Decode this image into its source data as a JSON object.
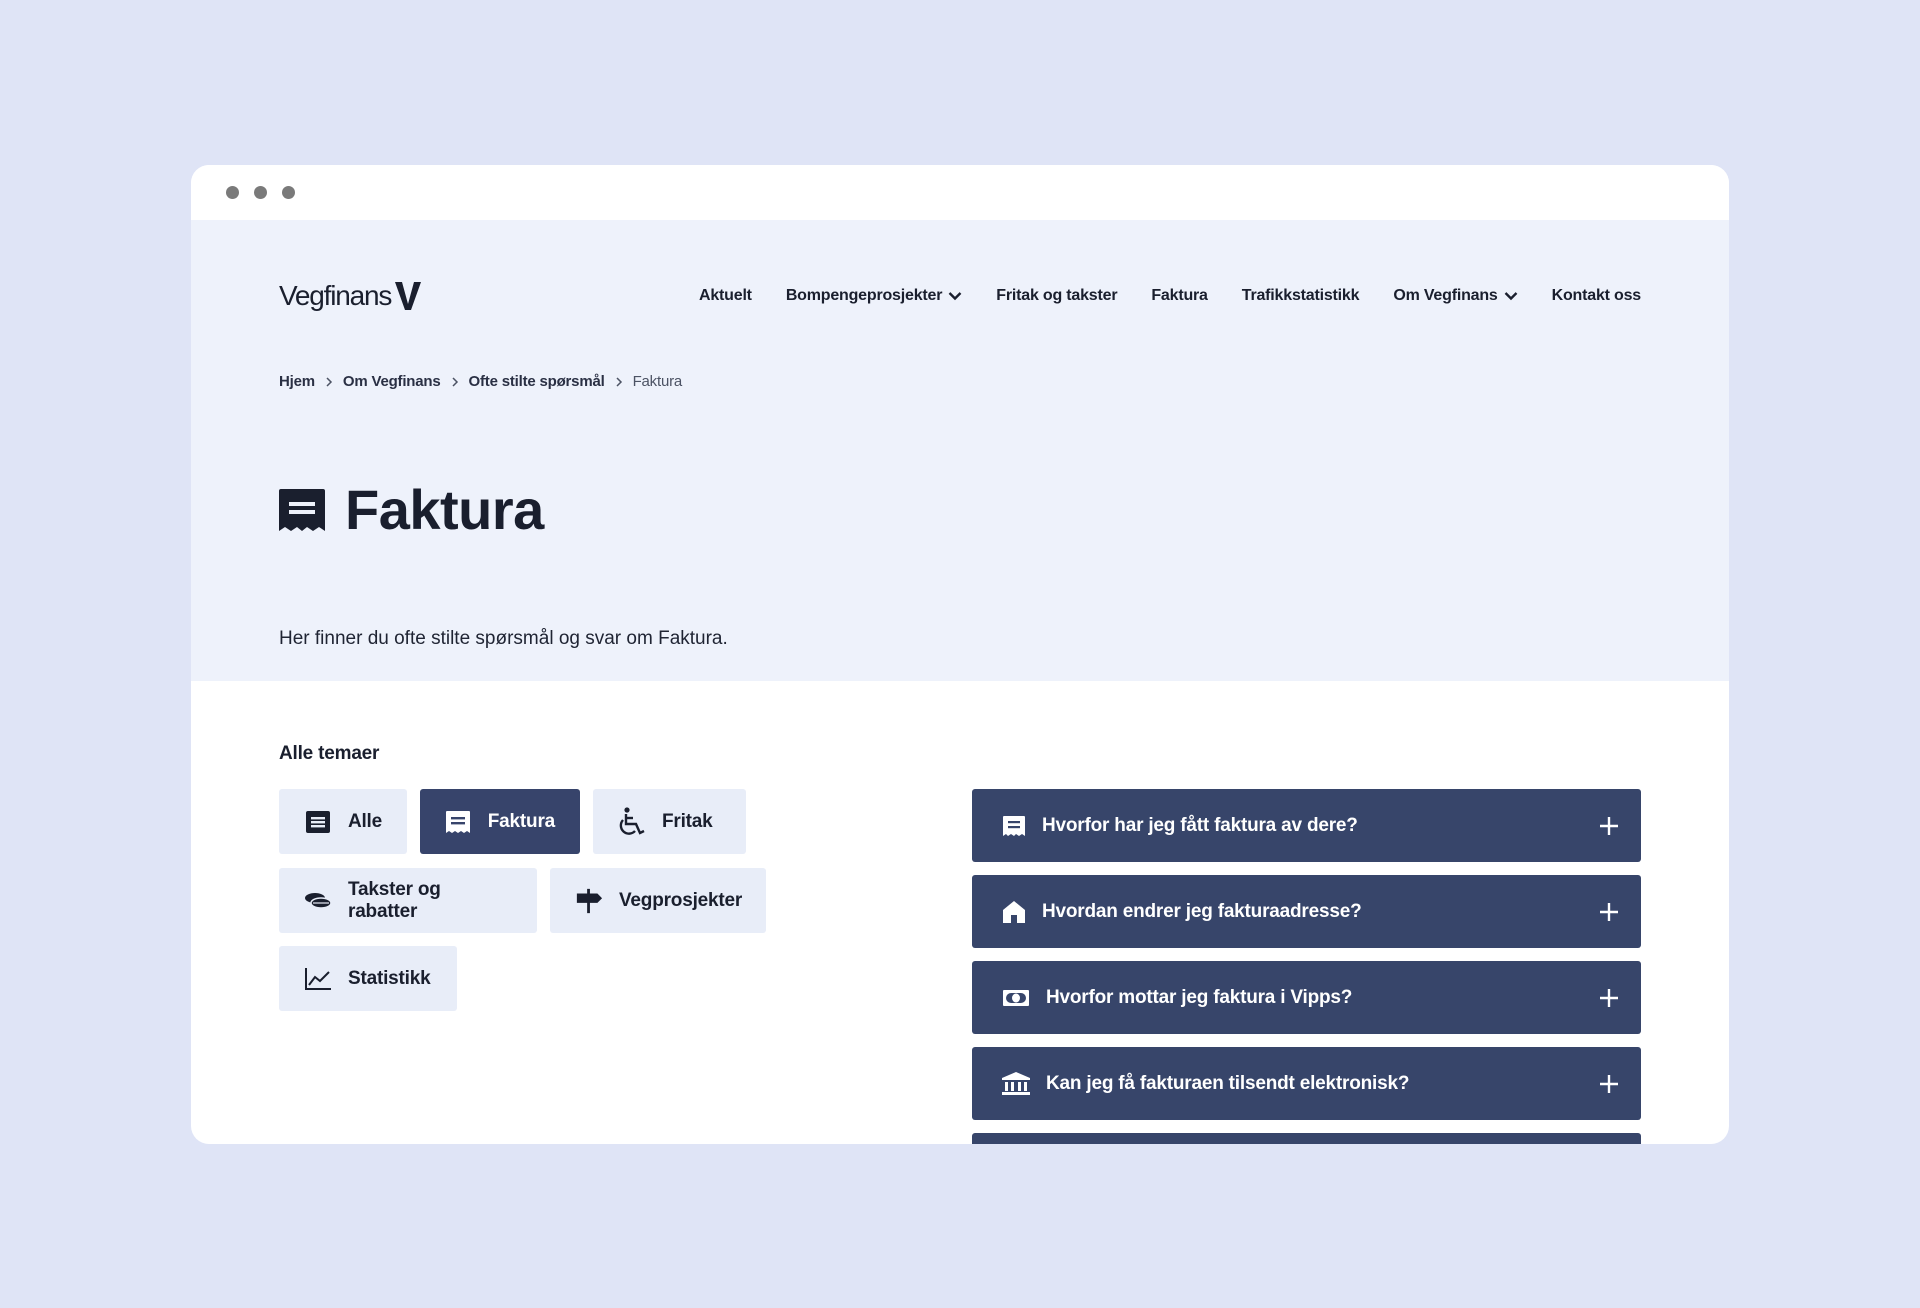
{
  "brand": {
    "name": "Vegfinans"
  },
  "nav": [
    {
      "label": "Aktuelt",
      "dropdown": false
    },
    {
      "label": "Bompengeprosjekter",
      "dropdown": true
    },
    {
      "label": "Fritak og takster",
      "dropdown": false
    },
    {
      "label": "Faktura",
      "dropdown": false
    },
    {
      "label": "Trafikkstatistikk",
      "dropdown": false
    },
    {
      "label": "Om Vegfinans",
      "dropdown": true
    },
    {
      "label": "Kontakt oss",
      "dropdown": false
    }
  ],
  "breadcrumb": [
    "Hjem",
    "Om Vegfinans",
    "Ofte stilte spørsmål",
    "Faktura"
  ],
  "page": {
    "title": "Faktura",
    "title_icon": "invoice-icon",
    "intro": "Her finner du ofte stilte spørsmål og svar om Faktura."
  },
  "themes": {
    "label": "Alle temaer",
    "chips": [
      {
        "label": "Alle",
        "icon": "list-icon",
        "active": false
      },
      {
        "label": "Faktura",
        "icon": "invoice-icon",
        "active": true
      },
      {
        "label": "Fritak",
        "icon": "wheelchair-icon",
        "active": false
      },
      {
        "label": "Takster og rabatter",
        "icon": "coins-icon",
        "active": false
      },
      {
        "label": "Vegprosjekter",
        "icon": "signpost-icon",
        "active": false
      },
      {
        "label": "Statistikk",
        "icon": "line-chart-icon",
        "active": false
      }
    ]
  },
  "faq": [
    {
      "question": "Hvorfor har jeg fått faktura av dere?",
      "icon": "invoice-icon"
    },
    {
      "question": "Hvordan endrer jeg fakturaadresse?",
      "icon": "house-icon"
    },
    {
      "question": "Hvorfor mottar jeg faktura i Vipps?",
      "icon": "money-icon"
    },
    {
      "question": "Kan jeg få fakturaen tilsendt elektronisk?",
      "icon": "bank-icon"
    }
  ],
  "colors": {
    "page_bg": "#dfe4f6",
    "hero_bg": "#eef2fb",
    "chip_bg": "#e8edf8",
    "accent_navy": "#37456a",
    "text": "#1a1f2e"
  }
}
